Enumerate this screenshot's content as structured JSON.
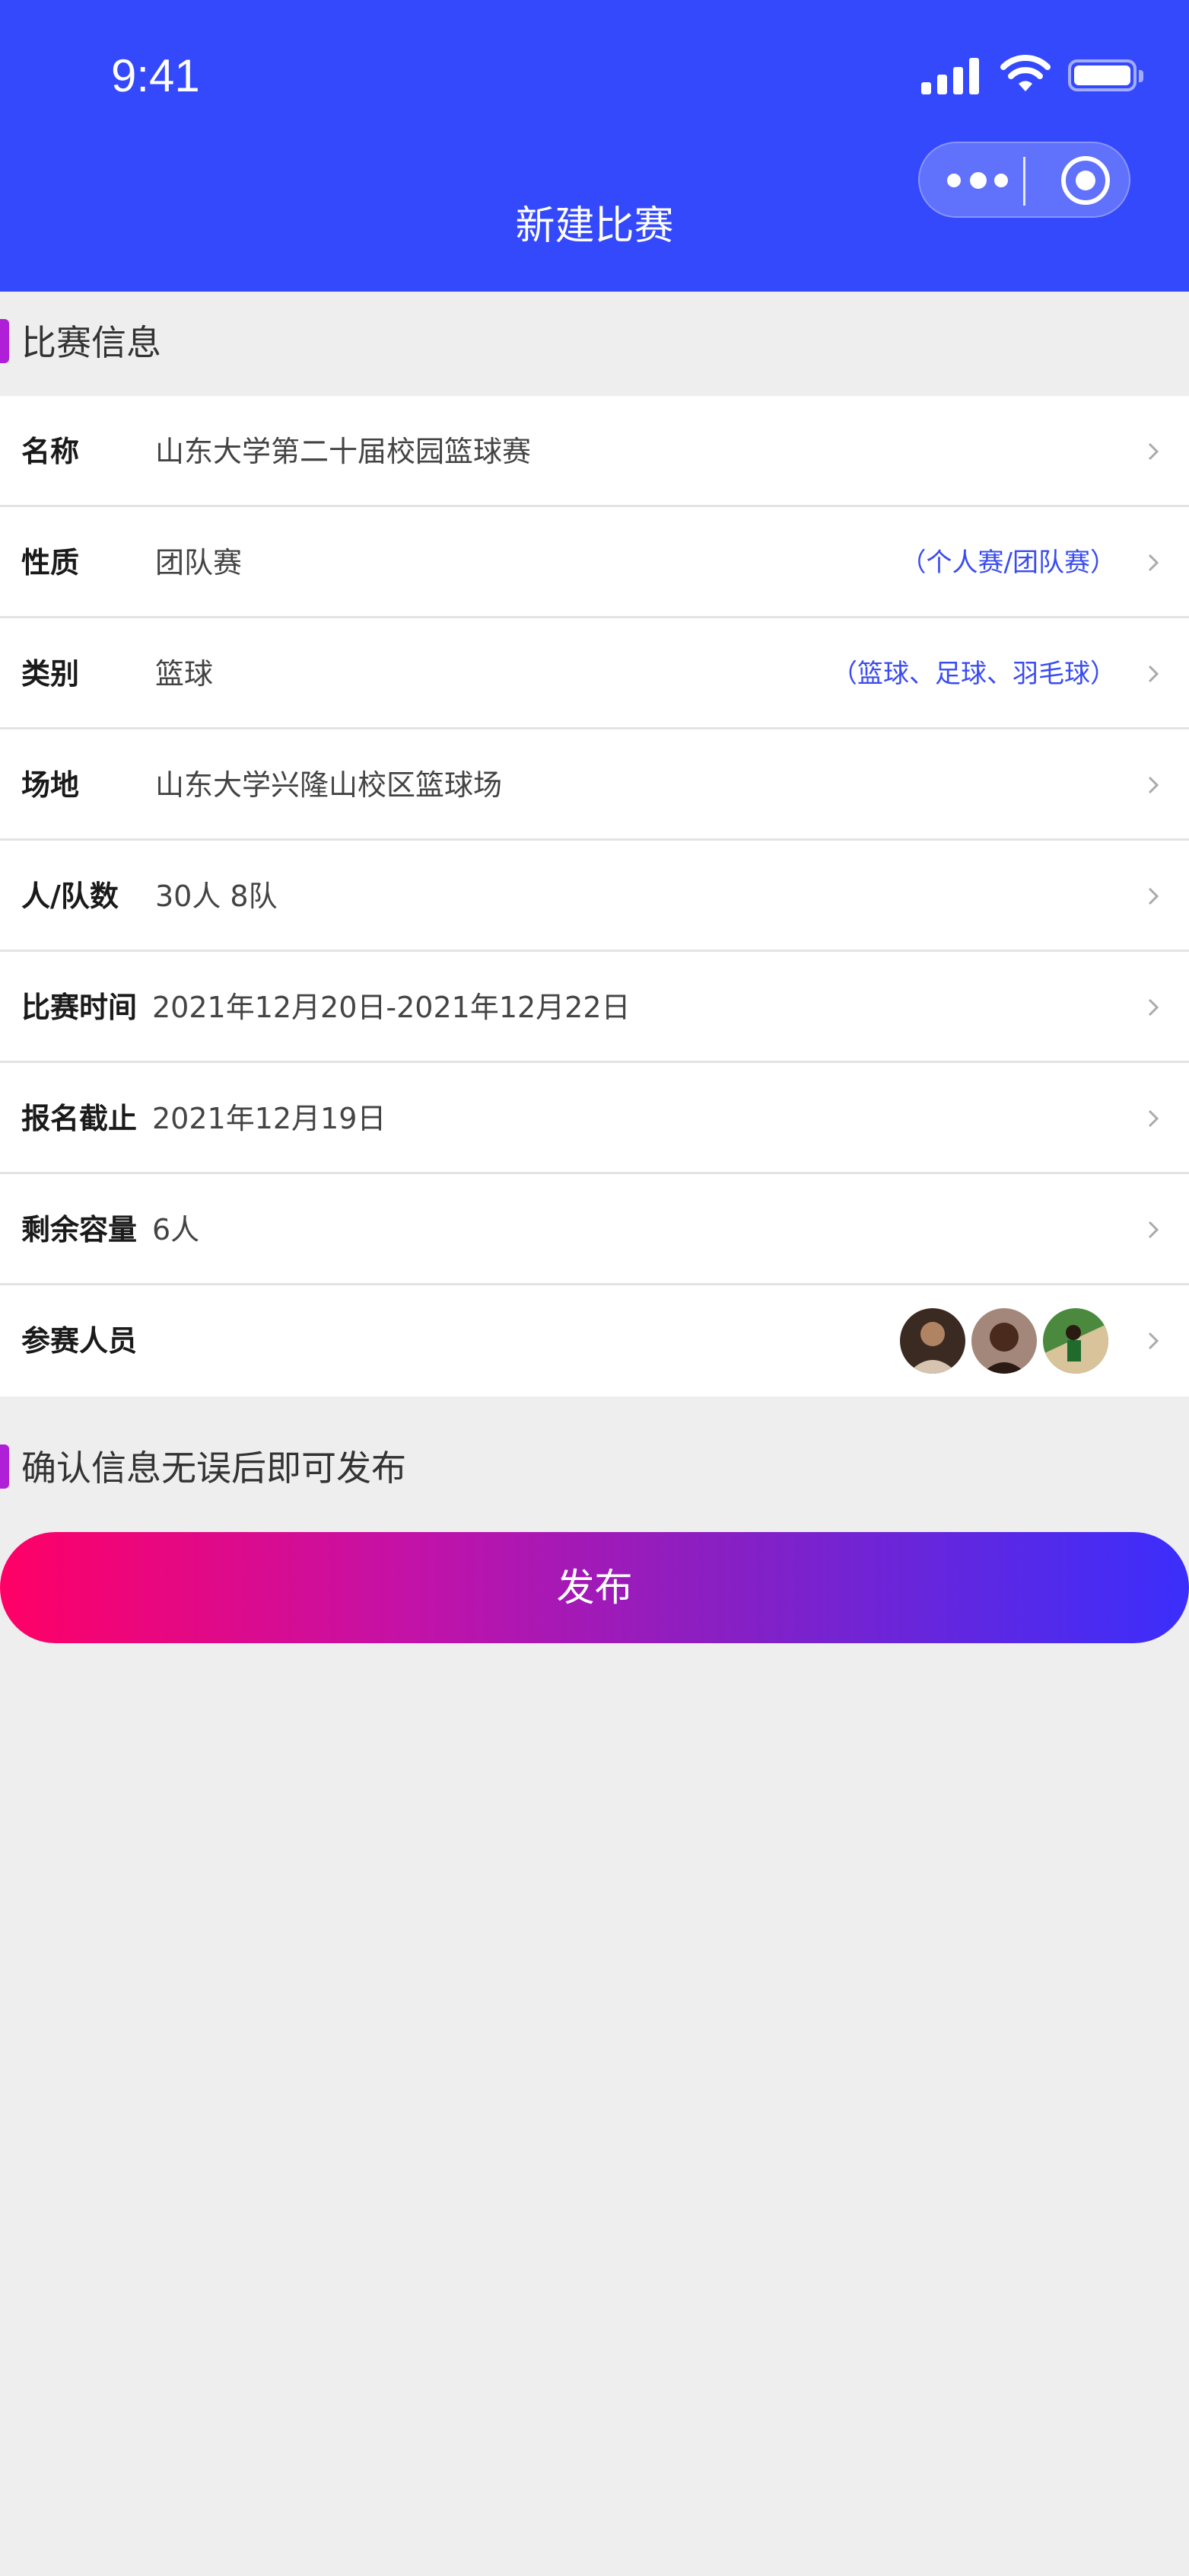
{
  "status_bar": {
    "time": "9:41"
  },
  "header": {
    "title": "新建比赛"
  },
  "section_info": {
    "label": "比赛信息"
  },
  "rows": [
    {
      "label": "名称",
      "value": "山东大学第二十届校园篮球赛",
      "hint": ""
    },
    {
      "label": "性质",
      "value": "团队赛",
      "hint": "（个人赛/团队赛）"
    },
    {
      "label": "类别",
      "value": "篮球",
      "hint": "（篮球、足球、羽毛球）"
    },
    {
      "label": "场地",
      "value": "山东大学兴隆山校区篮球场",
      "hint": ""
    },
    {
      "label": "人/队数",
      "value": "30人 8队",
      "hint": ""
    },
    {
      "label": "比赛时间",
      "value": "2021年12月20日-2021年12月22日",
      "hint": ""
    },
    {
      "label": "报名截止",
      "value": "2021年12月19日",
      "hint": ""
    },
    {
      "label": "剩余容量",
      "value": "6人",
      "hint": ""
    },
    {
      "label": "参赛人员",
      "value": "",
      "hint": ""
    }
  ],
  "participants": [
    {
      "icon": "player-avatar-1"
    },
    {
      "icon": "player-avatar-2"
    },
    {
      "icon": "player-avatar-3"
    }
  ],
  "section_confirm": {
    "label": "确认信息无误后即可发布"
  },
  "publish_button": {
    "label": "发布"
  },
  "colors": {
    "header_bg": "#3449fb",
    "accent_bar": "#b01fd8",
    "hint_text": "#3a4cf0",
    "button_gradient_start": "#ff0066",
    "button_gradient_end": "#3b2efc",
    "page_bg": "#eeeeee"
  }
}
